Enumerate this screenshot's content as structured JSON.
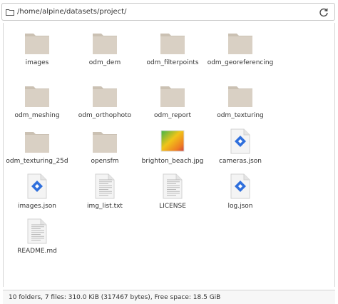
{
  "pathbar": {
    "path": "/home/alpine/datasets/project/"
  },
  "items": [
    {
      "label": "images",
      "icon": "folder-icon"
    },
    {
      "label": "odm_dem",
      "icon": "folder-icon"
    },
    {
      "label": "odm_filterpoints",
      "icon": "folder-icon"
    },
    {
      "label": "odm_georeferencing",
      "icon": "folder-icon"
    },
    {
      "label": "odm_meshing",
      "icon": "folder-icon"
    },
    {
      "label": "odm_orthophoto",
      "icon": "folder-icon"
    },
    {
      "label": "odm_report",
      "icon": "folder-icon"
    },
    {
      "label": "odm_texturing",
      "icon": "folder-icon"
    },
    {
      "label": "odm_texturing_25d",
      "icon": "folder-icon"
    },
    {
      "label": "opensfm",
      "icon": "folder-icon"
    },
    {
      "label": "brighton_beach.jpg",
      "icon": "image-file-icon"
    },
    {
      "label": "cameras.json",
      "icon": "json-file-icon"
    },
    {
      "label": "images.json",
      "icon": "json-file-icon"
    },
    {
      "label": "img_list.txt",
      "icon": "text-file-icon"
    },
    {
      "label": "LICENSE",
      "icon": "text-file-icon"
    },
    {
      "label": "log.json",
      "icon": "json-file-icon"
    },
    {
      "label": "README.md",
      "icon": "text-file-icon"
    }
  ],
  "status": {
    "text": "10 folders, 7 files: 310.0 KiB (317467 bytes), Free space: 18.5 GiB"
  },
  "colors": {
    "folder_body": "#d9d0c4",
    "folder_tab": "#cbc1b3",
    "json_blue": "#2f6fdc"
  }
}
